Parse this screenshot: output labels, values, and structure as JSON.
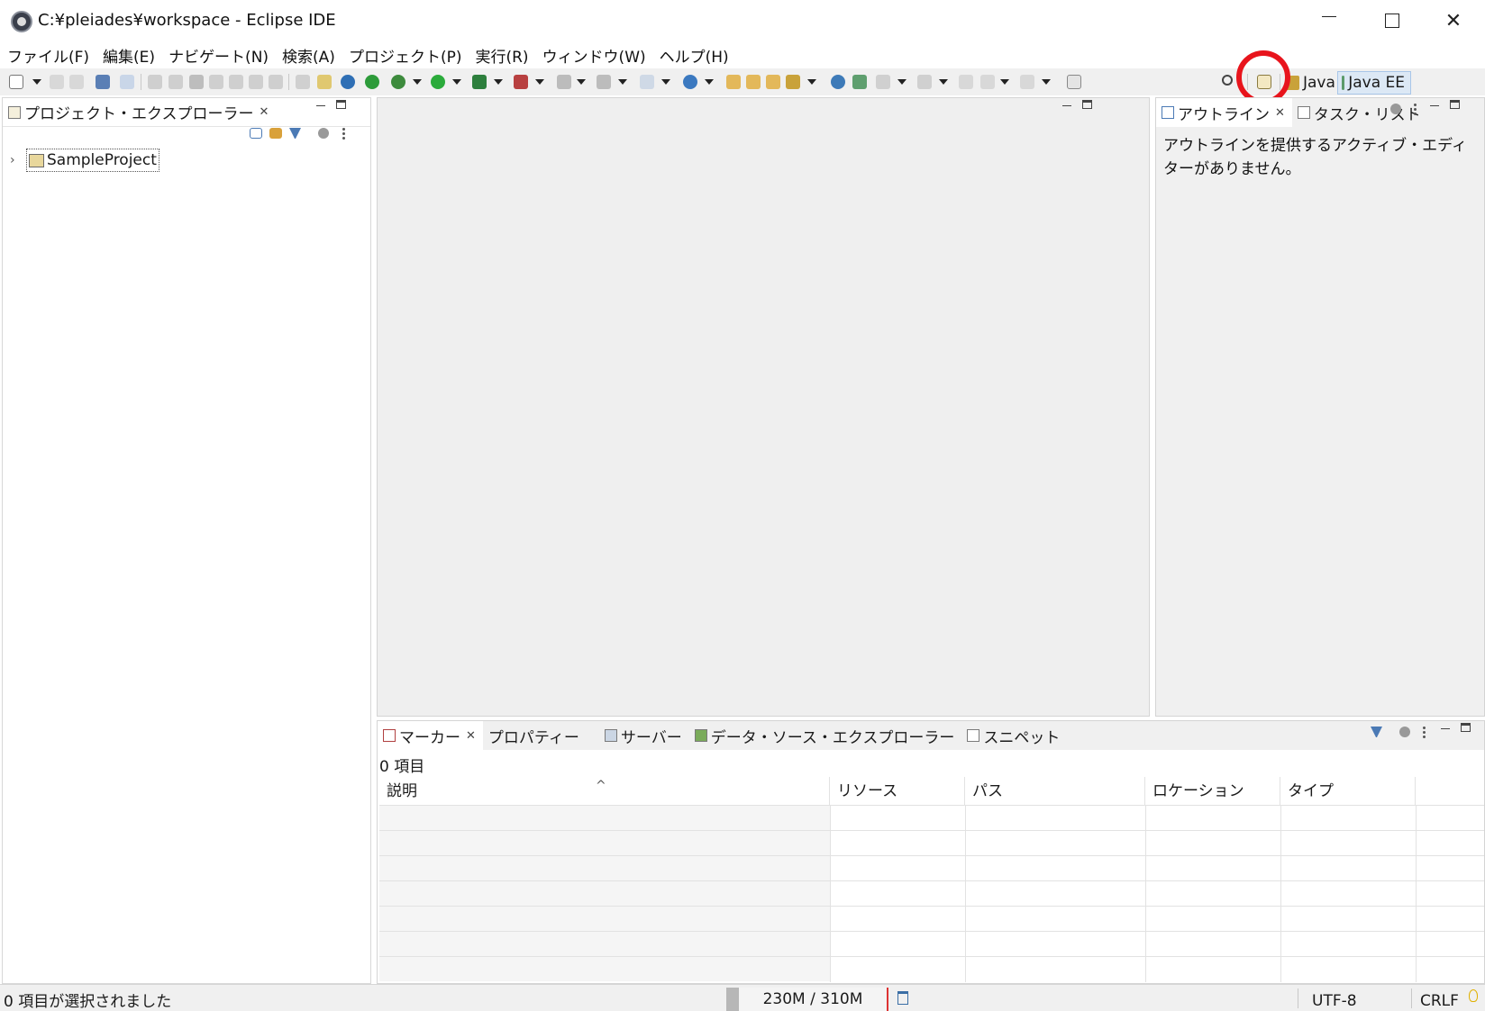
{
  "window": {
    "title": "C:¥pleiades¥workspace - Eclipse IDE"
  },
  "menu": [
    {
      "label": "ファイル(F)"
    },
    {
      "label": "編集(E)"
    },
    {
      "label": "ナビゲート(N)"
    },
    {
      "label": "検索(A)"
    },
    {
      "label": "プロジェクト(P)"
    },
    {
      "label": "実行(R)"
    },
    {
      "label": "ウィンドウ(W)"
    },
    {
      "label": "ヘルプ(H)"
    }
  ],
  "perspectives": {
    "java": "Java",
    "java_ee": "Java EE",
    "active": "Java EE"
  },
  "project_explorer": {
    "tab_label": "プロジェクト・エクスプローラー",
    "projects": [
      {
        "name": "SampleProject",
        "expanded": false
      }
    ]
  },
  "outline": {
    "tabs": [
      {
        "label": "アウトライン"
      },
      {
        "label": "タスク・リスト"
      }
    ],
    "message": "アウトラインを提供するアクティブ・エディターがありません。"
  },
  "bottom_panel": {
    "tabs": [
      {
        "label": "マーカー",
        "icon": "markers-icon"
      },
      {
        "label": "プロパティー",
        "icon": "properties-icon"
      },
      {
        "label": "サーバー",
        "icon": "servers-icon"
      },
      {
        "label": "データ・ソース・エクスプローラー",
        "icon": "datasource-icon"
      },
      {
        "label": "スニペット",
        "icon": "snippets-icon"
      }
    ],
    "items_count": "0 項目",
    "columns": [
      "説明",
      "リソース",
      "パス",
      "ロケーション",
      "タイプ"
    ],
    "rows": []
  },
  "status_bar": {
    "selection": "0 項目が選択されました",
    "heap": "230M / 310M",
    "encoding": "UTF-8",
    "line_ending": "CRLF"
  },
  "annotation": {
    "highlight_color": "#e8141c",
    "highlighted": "open-perspective-icon"
  }
}
